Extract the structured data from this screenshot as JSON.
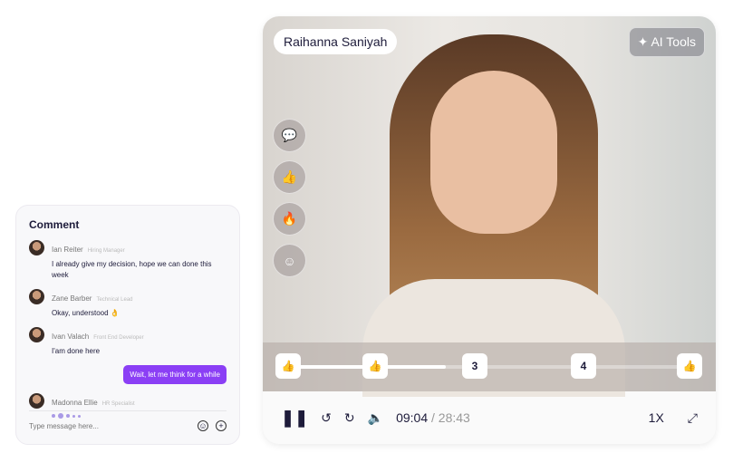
{
  "comment": {
    "title": "Comment",
    "messages": [
      {
        "name": "Ian Reiter",
        "role": "Hiring Manager",
        "text": "I already give my decision, hope we can done this week"
      },
      {
        "name": "Zane Barber",
        "role": "Technical Lead",
        "text": "Okay, understood 👌"
      },
      {
        "name": "Ivan Valach",
        "role": "Front End Developer",
        "text": "I'am done here"
      }
    ],
    "my_message": "Wait, let me think for a while",
    "typing": {
      "name": "Madonna Ellie",
      "role": "HR Specialist"
    },
    "input_placeholder": "Type message here..."
  },
  "player": {
    "participant": "Raihanna Saniyah",
    "ai_tools": "✦ AI Tools",
    "markers": [
      "👍",
      "👍",
      "3",
      "4",
      "👍"
    ],
    "progress_percent": 39,
    "current_time": "09:04",
    "total_time": "/ 28:43",
    "speed": "1X"
  }
}
